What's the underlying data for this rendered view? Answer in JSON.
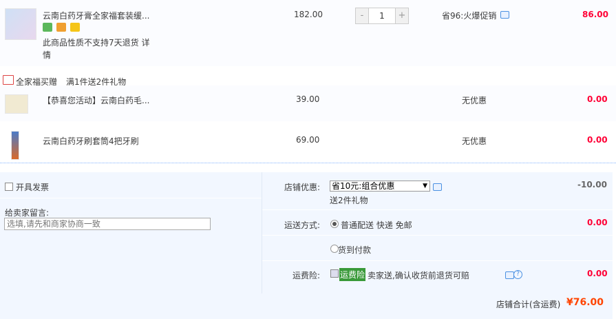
{
  "main_item": {
    "title": "云南白药牙膏全家福套装缓...",
    "price": "182.00",
    "quantity": "1",
    "qty_minus": "-",
    "qty_plus": "+",
    "promo": "省96:火爆促销",
    "subtotal": "86.00",
    "notice": "此商品性质不支持7天退货",
    "detail_link": "详",
    "notice_tail": "情"
  },
  "gift_section": {
    "name": "全家福买赠",
    "desc": "满1件送2件礼物",
    "items": [
      {
        "title": "【恭喜您活动】云南白药毛...",
        "price": "39.00",
        "promo": "无优惠",
        "subtotal": "0.00"
      },
      {
        "title": "云南白药牙刷套筒4把牙刷",
        "price": "69.00",
        "promo": "无优惠",
        "subtotal": "0.00"
      }
    ]
  },
  "invoice": {
    "label": "开具发票"
  },
  "message": {
    "label": "给卖家留言:",
    "placeholder": "选填,请先和商家协商一致"
  },
  "shop_discount": {
    "label": "店铺优惠:",
    "selected": "省10元:组合优惠",
    "note": "送2件礼物",
    "amount": "-10.00"
  },
  "shipping": {
    "label": "运送方式:",
    "option1": "普通配送 快递 免邮",
    "option2": "货到付款",
    "amount": "0.00"
  },
  "insurance": {
    "label": "运费险:",
    "tag": "运费险",
    "desc": "卖家送,确认收货前退货可赔",
    "amount": "0.00"
  },
  "total": {
    "label": "店铺合计(含运费)",
    "value": "¥76.00"
  },
  "colors": {
    "price_red": "#ff0036",
    "total_red": "#ff4400",
    "panel_bg": "#f2f7ff",
    "row_bg": "#fbfcff"
  }
}
